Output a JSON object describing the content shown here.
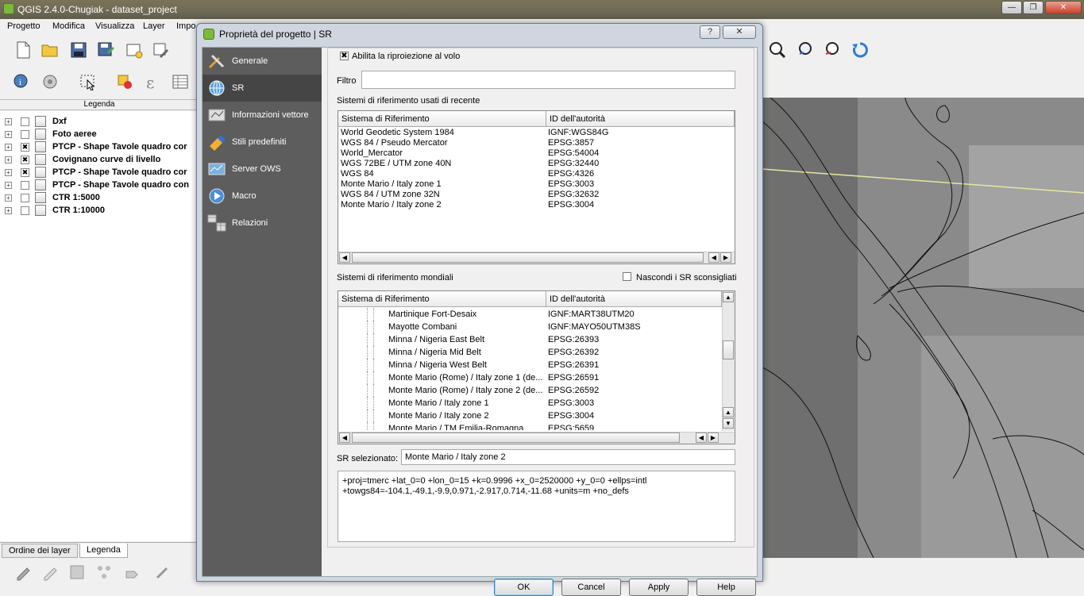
{
  "main_window": {
    "title": "QGIS 2.4.0-Chugiak - dataset_project",
    "controls": {
      "minimize": "—",
      "maximize": "❐",
      "close": "✕"
    }
  },
  "menubar": [
    "Progetto",
    "Modifica",
    "Visualizza",
    "Layer",
    "Impo"
  ],
  "legend": {
    "header": "Legenda",
    "layers": [
      {
        "name": "Dxf",
        "checked": false
      },
      {
        "name": "Foto aeree",
        "checked": false
      },
      {
        "name": "PTCP - Shape  Tavole quadro cor",
        "checked": true
      },
      {
        "name": "Covignano curve di livello",
        "checked": true
      },
      {
        "name": "PTCP - Shape  Tavole quadro cor",
        "checked": true
      },
      {
        "name": "PTCP - Shape Tavole quadro con",
        "checked": false
      },
      {
        "name": "CTR 1:5000",
        "checked": false
      },
      {
        "name": "CTR 1:10000",
        "checked": false
      }
    ],
    "tabs": [
      "Ordine dei layer",
      "Legenda"
    ],
    "active_tab": "Legenda"
  },
  "dialog": {
    "title": "Proprietà del progetto | SR",
    "help_button": "?",
    "close_button": "✕",
    "sidebar": [
      {
        "label": "Generale",
        "icon": "tools-icon"
      },
      {
        "label": "SR",
        "icon": "globe-icon",
        "selected": true
      },
      {
        "label": "Informazioni vettore",
        "icon": "vector-info-icon"
      },
      {
        "label": "Stili predefiniti",
        "icon": "paint-icon"
      },
      {
        "label": "Server OWS",
        "icon": "server-icon"
      },
      {
        "label": "Macro",
        "icon": "macro-icon"
      },
      {
        "label": "Relazioni",
        "icon": "relations-icon"
      }
    ],
    "reprojection_label": "Abilita la riproiezione al volo",
    "reprojection_checked": true,
    "filter_label": "Filtro",
    "filter_value": "",
    "recent_label": "Sistemi di riferimento usati di recente",
    "col_system": "Sistema di Riferimento",
    "col_authority": "ID dell'autorità",
    "recent_rows": [
      {
        "name": "World Geodetic System 1984",
        "id": "IGNF:WGS84G"
      },
      {
        "name": "WGS 84 / Pseudo Mercator",
        "id": "EPSG:3857"
      },
      {
        "name": "World_Mercator",
        "id": "EPSG:54004"
      },
      {
        "name": "WGS 72BE / UTM zone 40N",
        "id": "EPSG:32440"
      },
      {
        "name": "WGS 84",
        "id": "EPSG:4326"
      },
      {
        "name": "Monte Mario / Italy zone 1",
        "id": "EPSG:3003"
      },
      {
        "name": "WGS 84 / UTM zone 32N",
        "id": "EPSG:32632"
      },
      {
        "name": "Monte Mario / Italy zone 2",
        "id": "EPSG:3004"
      }
    ],
    "world_label": "Sistemi di riferimento mondiali",
    "hide_deprecated_label": "Nascondi i SR sconsigliati",
    "hide_deprecated_checked": false,
    "world_rows": [
      {
        "name": "Martinique Fort-Desaix",
        "id": "IGNF:MART38UTM20"
      },
      {
        "name": "Mayotte Combani",
        "id": "IGNF:MAYO50UTM38S"
      },
      {
        "name": "Minna / Nigeria East Belt",
        "id": "EPSG:26393"
      },
      {
        "name": "Minna / Nigeria Mid Belt",
        "id": "EPSG:26392"
      },
      {
        "name": "Minna / Nigeria West Belt",
        "id": "EPSG:26391"
      },
      {
        "name": "Monte Mario (Rome) / Italy zone 1 (de...",
        "id": "EPSG:26591"
      },
      {
        "name": "Monte Mario (Rome) / Italy zone 2 (de...",
        "id": "EPSG:26592"
      },
      {
        "name": "Monte Mario / Italy zone 1",
        "id": "EPSG:3003"
      },
      {
        "name": "Monte Mario / Italy zone 2",
        "id": "EPSG:3004"
      },
      {
        "name": "Monte Mario / TM Emilia-Romagna",
        "id": "EPSG:5659"
      }
    ],
    "selected_label": "SR selezionato:",
    "selected_value": "Monte Mario / Italy zone 2",
    "proj_string": "+proj=tmerc +lat_0=0 +lon_0=15 +k=0.9996 +x_0=2520000 +y_0=0 +ellps=intl\n+towgs84=-104.1,-49.1,-9.9,0.971,-2.917,0.714,-11.68 +units=m +no_defs",
    "buttons": {
      "ok": "OK",
      "cancel": "Cancel",
      "apply": "Apply",
      "help": "Help"
    }
  }
}
